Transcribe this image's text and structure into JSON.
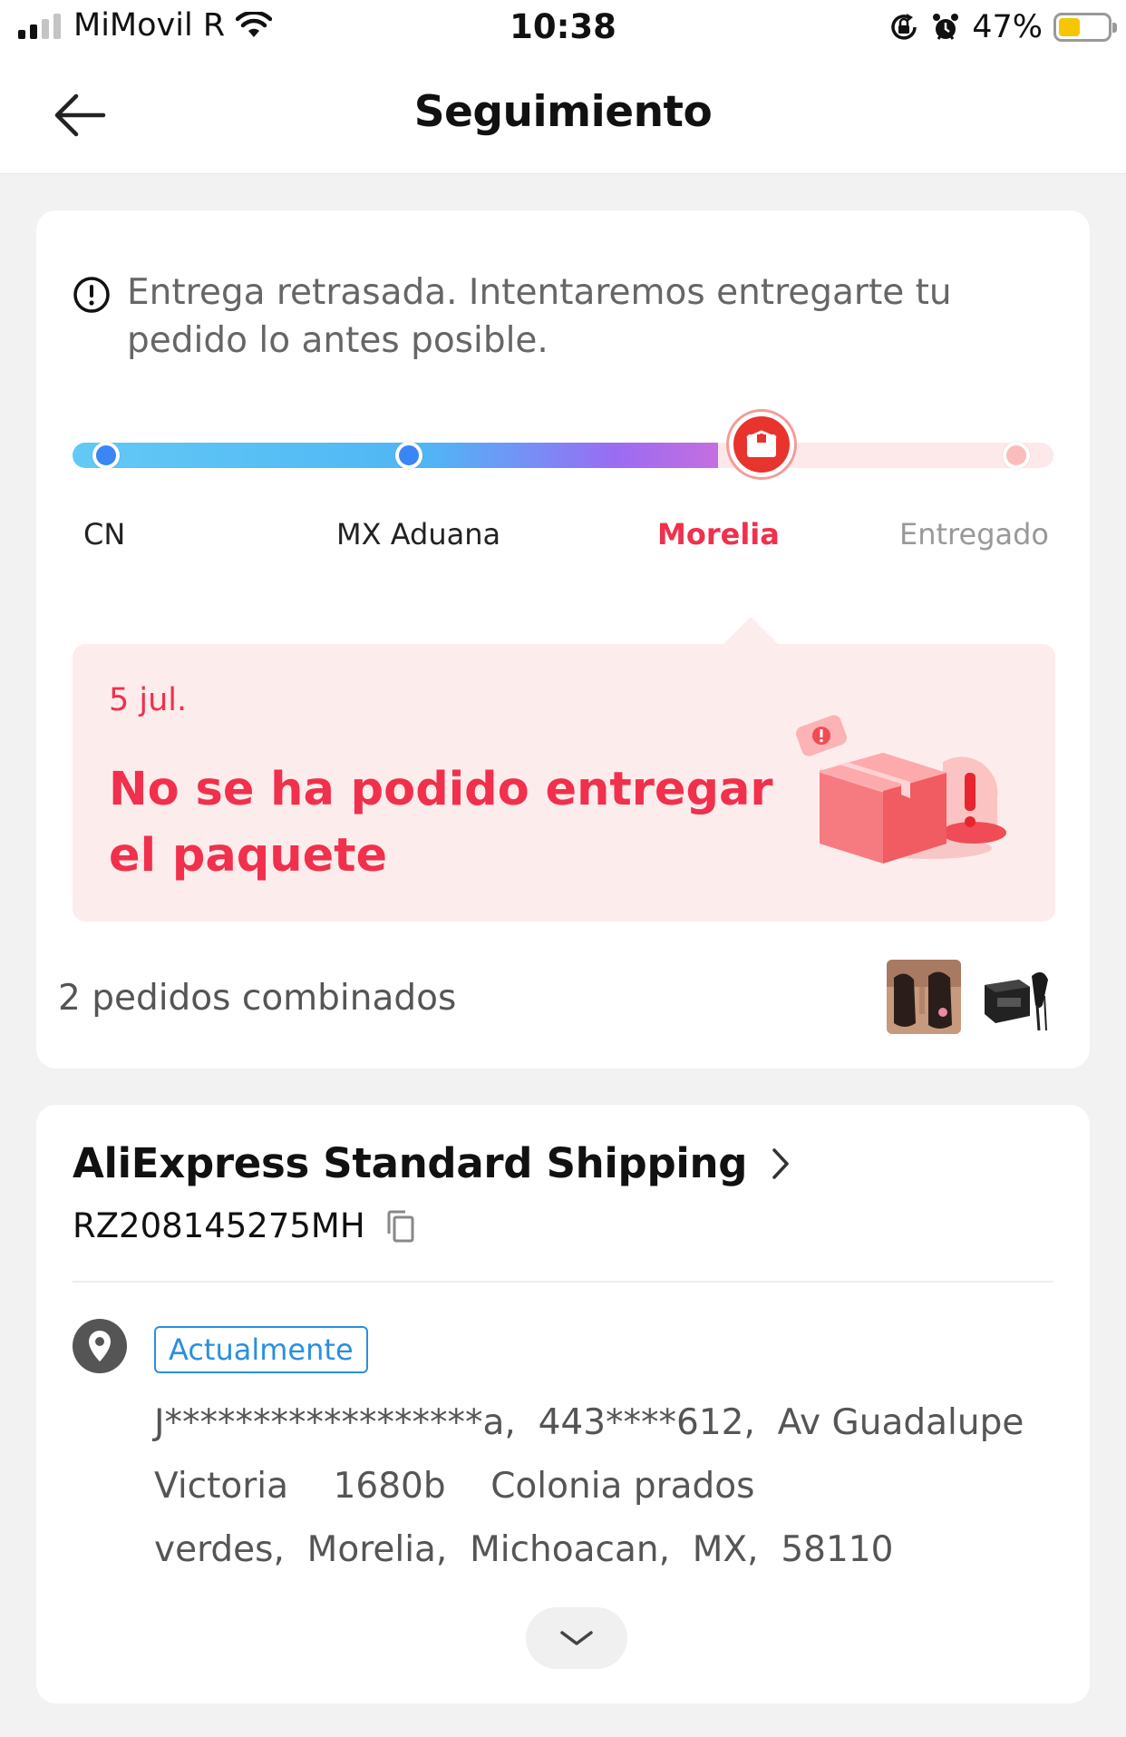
{
  "status_bar": {
    "carrier": "MiMovil R",
    "time": "10:38",
    "battery_percent": "47%",
    "battery_level": 0.47,
    "icons": [
      "signal-icon",
      "wifi-icon",
      "orientation-lock-icon",
      "alarm-icon",
      "battery-icon"
    ]
  },
  "header": {
    "title": "Seguimiento",
    "back_icon": "arrow-left-icon"
  },
  "progress": {
    "alert_text": "Entrega retrasada. Intentaremos entregarte tu pedido lo antes posible.",
    "alert_icon": "exclamation-circle-icon",
    "steps": [
      {
        "label": "CN",
        "state": "done"
      },
      {
        "label": "MX Aduana",
        "state": "done"
      },
      {
        "label": "Morelia",
        "state": "current"
      },
      {
        "label": "Entregado",
        "state": "pending"
      }
    ],
    "current_step_icon": "package-icon",
    "colors": {
      "active": "#f0304c",
      "done": "#3a86f5",
      "pending": "#999999"
    }
  },
  "status": {
    "date": "5 jul.",
    "message": "No se ha podido entregar el paquete",
    "illustration": "box-warning-icon"
  },
  "combined": {
    "text": "2 pedidos combinados",
    "thumbnails": [
      "product-thumbnail-lingerie",
      "product-thumbnail-receipt-printer"
    ]
  },
  "shipping": {
    "carrier": "AliExpress Standard Shipping",
    "tracking_number": "RZ208145275MH",
    "badge": "Actualmente",
    "address_lines": [
      "J******************a,  443****612,  Av Guadalupe",
      "Victoria    1680b    Colonia prados",
      "verdes,  Morelia,  Michoacan,  MX,  58110"
    ],
    "icons": [
      "chevron-right-icon",
      "copy-icon",
      "location-pin-icon",
      "chevron-down-icon"
    ]
  }
}
